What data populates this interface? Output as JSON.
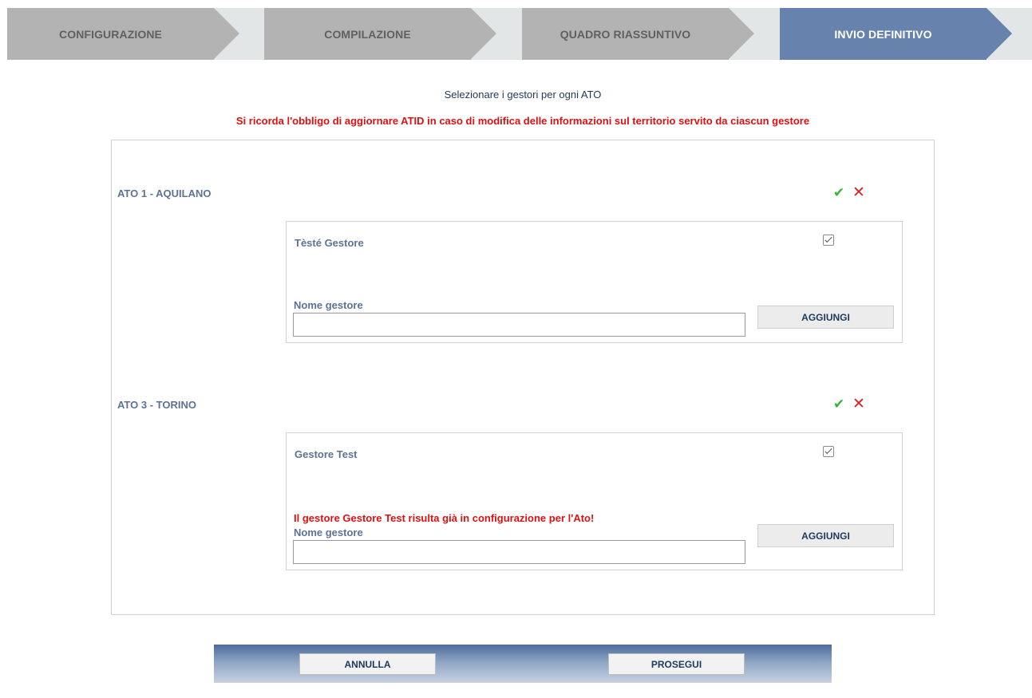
{
  "steps": [
    {
      "label": "CONFIGURAZIONE",
      "state": "done"
    },
    {
      "label": "COMPILAZIONE",
      "state": "done"
    },
    {
      "label": "QUADRO RIASSUNTIVO",
      "state": "done"
    },
    {
      "label": "INVIO DEFINITIVO",
      "state": "active"
    }
  ],
  "subtitle": "Selezionare i gestori per ogni ATO",
  "warning": "Si ricorda l'obbligo di aggiornare ATID in caso di modifica delle informazioni sul territorio servito da ciascun gestore",
  "atos": [
    {
      "title": "ATO 1 - AQUILANO",
      "gestore": {
        "name": "Tèsté Gestore",
        "checked": true
      },
      "error": "",
      "field_label": "Nome gestore",
      "field_value": "",
      "add_label": "AGGIUNGI"
    },
    {
      "title": "ATO 3 - TORINO",
      "gestore": {
        "name": "Gestore Test",
        "checked": true
      },
      "error": "Il gestore Gestore Test risulta già in configurazione per l'Ato!",
      "field_label": "Nome gestore",
      "field_value": "",
      "add_label": "AGGIUNGI"
    }
  ],
  "icons": {
    "confirm": "check-icon",
    "remove": "close-icon"
  },
  "colors": {
    "accent": "#6783ad",
    "error": "#e01010",
    "confirm": "#36b53a",
    "label": "#5c7395"
  },
  "footer": {
    "cancel_label": "ANNULLA",
    "continue_label": "PROSEGUI"
  }
}
